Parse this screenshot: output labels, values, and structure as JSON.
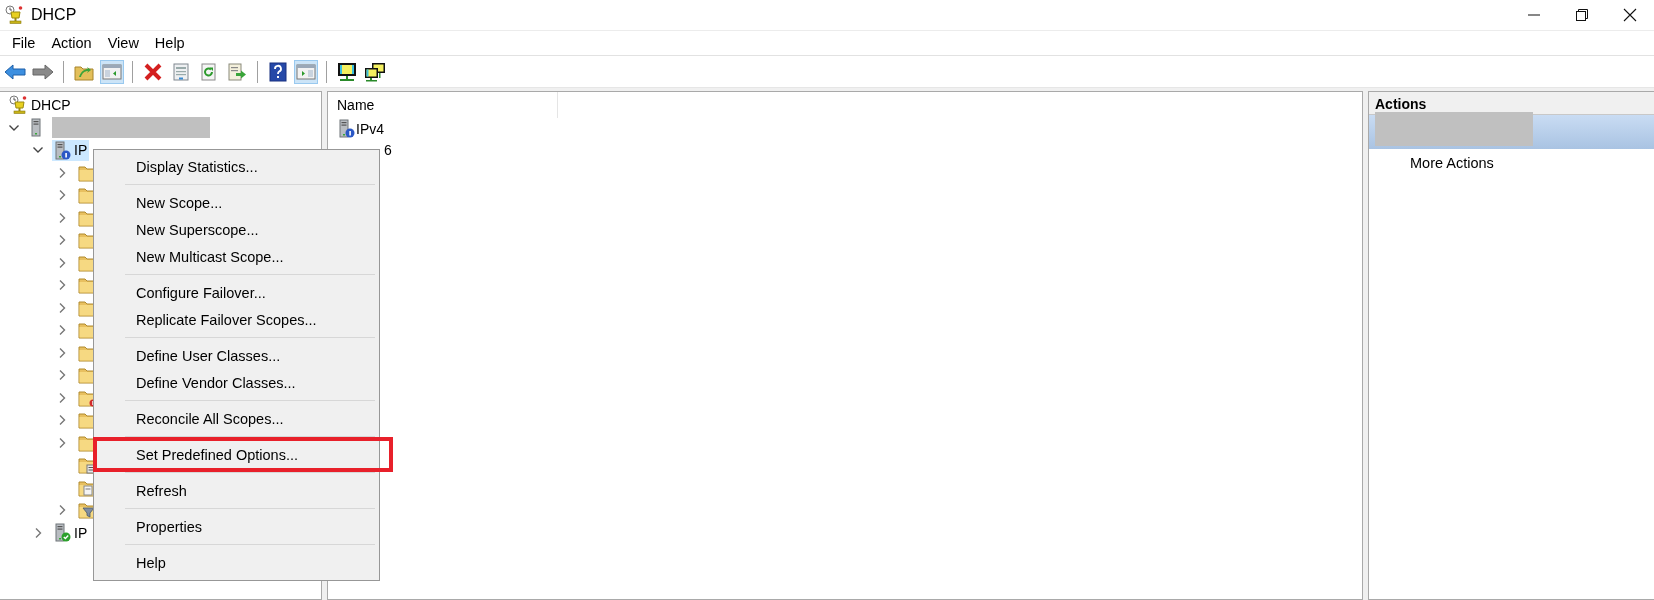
{
  "window": {
    "title": "DHCP"
  },
  "menu_bar": [
    "File",
    "Action",
    "View",
    "Help"
  ],
  "toolbar": [
    {
      "kind": "back",
      "pressed": false
    },
    {
      "kind": "forward",
      "pressed": false
    },
    {
      "kind": "separator"
    },
    {
      "kind": "up",
      "pressed": false
    },
    {
      "kind": "tree-pane",
      "pressed": true
    },
    {
      "kind": "separator"
    },
    {
      "kind": "delete",
      "pressed": false
    },
    {
      "kind": "properties",
      "pressed": false
    },
    {
      "kind": "refresh",
      "pressed": false
    },
    {
      "kind": "export",
      "pressed": false
    },
    {
      "kind": "separator"
    },
    {
      "kind": "help",
      "pressed": false
    },
    {
      "kind": "action-pane",
      "pressed": true
    },
    {
      "kind": "separator"
    },
    {
      "kind": "monitor",
      "pressed": false
    },
    {
      "kind": "monitors",
      "pressed": false
    }
  ],
  "tree": [
    {
      "kind": "dhcp",
      "label": "DHCP",
      "selected": false,
      "children": [
        {
          "kind": "server",
          "redacted": true,
          "expanded": true,
          "selected": false,
          "children": [
            {
              "kind": "server-ipv4",
              "label": "IP",
              "expanded": true,
              "selected": true,
              "children": [
                {
                  "kind": "folder",
                  "expanded": false,
                  "selected": false
                },
                {
                  "kind": "folder",
                  "expanded": false,
                  "selected": false
                },
                {
                  "kind": "folder",
                  "expanded": false,
                  "selected": false
                },
                {
                  "kind": "folder",
                  "expanded": false,
                  "selected": false
                },
                {
                  "kind": "folder",
                  "expanded": false,
                  "selected": false
                },
                {
                  "kind": "folder",
                  "expanded": false,
                  "selected": false
                },
                {
                  "kind": "folder",
                  "expanded": false,
                  "selected": false
                },
                {
                  "kind": "folder",
                  "expanded": false,
                  "selected": false
                },
                {
                  "kind": "folder",
                  "expanded": false,
                  "selected": false
                },
                {
                  "kind": "folder",
                  "expanded": false,
                  "selected": false
                },
                {
                  "kind": "folder-alert",
                  "expanded": false,
                  "selected": false
                },
                {
                  "kind": "folder",
                  "expanded": false,
                  "selected": false
                },
                {
                  "kind": "folder",
                  "expanded": false,
                  "selected": false
                },
                {
                  "kind": "folder-list",
                  "selected": false
                },
                {
                  "kind": "folder-note",
                  "selected": false
                },
                {
                  "kind": "folder-filter",
                  "expanded": false,
                  "selected": false
                }
              ]
            },
            {
              "kind": "server-ipv6",
              "label": "IP",
              "expanded": false,
              "selected": false
            }
          ]
        }
      ]
    }
  ],
  "list_pane": {
    "columns": [
      "Name"
    ],
    "rows": [
      {
        "kind": "server-ipv4",
        "name": "IPv4"
      },
      {
        "kind": "covered",
        "name": "6"
      }
    ]
  },
  "actions_pane": {
    "title": "Actions",
    "group": {
      "redacted": true,
      "selected": true
    },
    "items": [
      "More Actions"
    ]
  },
  "context_menu": {
    "groups": [
      [
        {
          "label": "Display Statistics...",
          "highlighted": false
        }
      ],
      [
        {
          "label": "New Scope...",
          "highlighted": false
        },
        {
          "label": "New Superscope...",
          "highlighted": false
        },
        {
          "label": "New Multicast Scope...",
          "highlighted": false
        }
      ],
      [
        {
          "label": "Configure Failover...",
          "highlighted": false
        },
        {
          "label": "Replicate Failover Scopes...",
          "highlighted": false
        }
      ],
      [
        {
          "label": "Define User Classes...",
          "highlighted": false
        },
        {
          "label": "Define Vendor Classes...",
          "highlighted": false
        }
      ],
      [
        {
          "label": "Reconcile All Scopes...",
          "highlighted": false
        }
      ],
      [
        {
          "label": "Set Predefined Options...",
          "highlighted": true
        }
      ],
      [
        {
          "label": "Refresh",
          "highlighted": false
        }
      ],
      [
        {
          "label": "Properties",
          "highlighted": false
        }
      ],
      [
        {
          "label": "Help",
          "highlighted": false
        }
      ]
    ]
  }
}
